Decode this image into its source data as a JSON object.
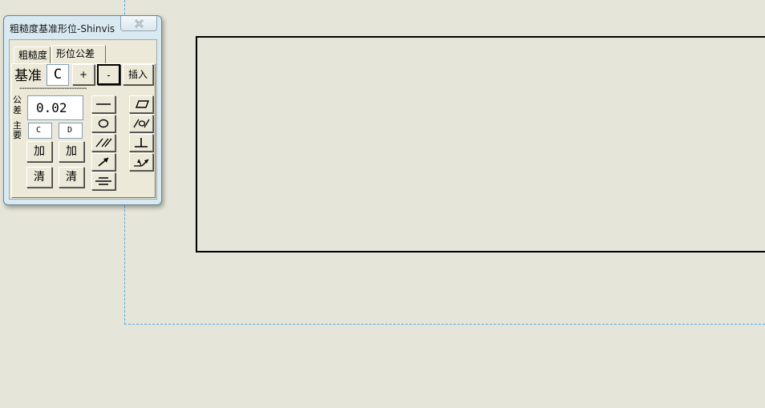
{
  "window": {
    "title": "粗糙度基准形位-Shinvis"
  },
  "tabs": [
    {
      "label": "粗糙度",
      "active": false
    },
    {
      "label": "形位公差",
      "active": true
    }
  ],
  "datum": {
    "label": "基准",
    "value": "C",
    "plus_label": "+",
    "minus_label": "-",
    "insert_label": "插入",
    "separator": "---------------------------"
  },
  "tolerance": {
    "label_top": "公差",
    "value": "0.02",
    "label_bottom": "主要",
    "primary_datum": "C",
    "secondary_datum": "D",
    "add_label_1": "加",
    "add_label_2": "加",
    "clear_label_1": "清",
    "clear_label_2": "清"
  },
  "symbols": {
    "column1": [
      "straightness-icon",
      "circularity-icon",
      "parallelism-icon",
      "circular-runout-icon",
      "symmetry-icon"
    ],
    "column2": [
      "flatness-icon",
      "cylindricity-icon",
      "perpendicularity-icon",
      "total-runout-icon"
    ]
  },
  "colors": {
    "canvas": "#e6e5d9",
    "dialog_frame": "#d9e9f2",
    "guide_line": "#5aa8e0"
  }
}
